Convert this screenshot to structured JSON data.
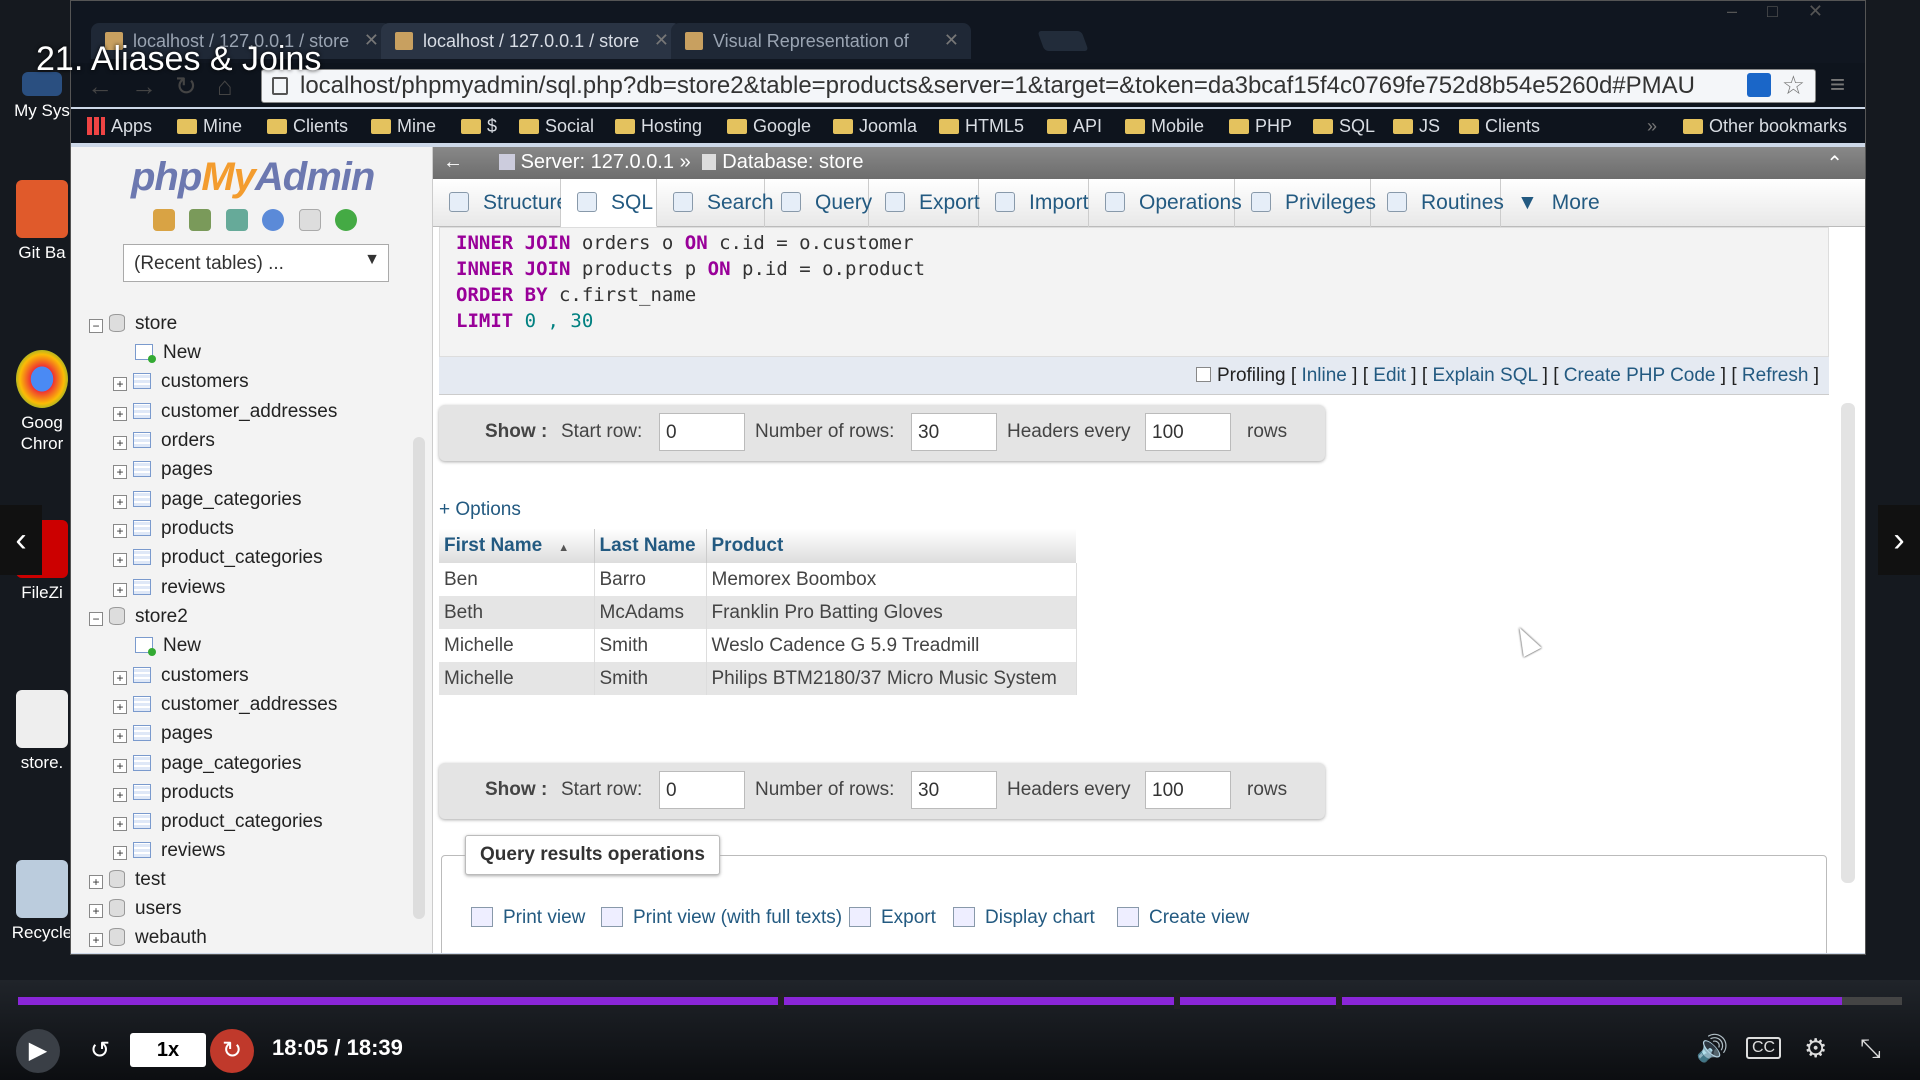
{
  "video": {
    "title": "21. Aliases & Joins",
    "speed": "1x",
    "time": "18:05 / 18:39",
    "progress_fraction": 0.968
  },
  "desktop": {
    "icons": [
      "My Sys",
      "Git Ba",
      "Goog Chror",
      "FileZi",
      "store.",
      "Recycle"
    ]
  },
  "browser": {
    "tabs": [
      {
        "title": "localhost / 127.0.0.1 / store"
      },
      {
        "title": "localhost / 127.0.0.1 / store"
      },
      {
        "title": "Visual Representation of"
      }
    ],
    "url": "localhost/phpmyadmin/sql.php?db=store2&table=products&server=1&target=&token=da3bcaf15f4c0769fe752d8b54e5260d#PMAU",
    "bookmarks": [
      "Apps",
      "Mine",
      "Clients",
      "Mine",
      "$",
      "Social",
      "Hosting",
      "Google",
      "Joomla",
      "HTML5",
      "API",
      "Mobile",
      "PHP",
      "SQL",
      "JS",
      "Clients"
    ],
    "bookmarks_more": "»",
    "other_bookmarks": "Other bookmarks"
  },
  "sidebar": {
    "logo": {
      "php": "php",
      "my": "My",
      "admin": "Admin"
    },
    "recent_tables": "(Recent tables) ...",
    "tree": [
      {
        "label": "store",
        "type": "db",
        "expanded": true
      },
      {
        "label": "New",
        "type": "new"
      },
      {
        "label": "customers",
        "type": "table"
      },
      {
        "label": "customer_addresses",
        "type": "table"
      },
      {
        "label": "orders",
        "type": "table"
      },
      {
        "label": "pages",
        "type": "table"
      },
      {
        "label": "page_categories",
        "type": "table"
      },
      {
        "label": "products",
        "type": "table"
      },
      {
        "label": "product_categories",
        "type": "table"
      },
      {
        "label": "reviews",
        "type": "table"
      },
      {
        "label": "store2",
        "type": "db",
        "expanded": true
      },
      {
        "label": "New",
        "type": "new"
      },
      {
        "label": "customers",
        "type": "table"
      },
      {
        "label": "customer_addresses",
        "type": "table"
      },
      {
        "label": "pages",
        "type": "table"
      },
      {
        "label": "page_categories",
        "type": "table"
      },
      {
        "label": "products",
        "type": "table"
      },
      {
        "label": "product_categories",
        "type": "table"
      },
      {
        "label": "reviews",
        "type": "table"
      },
      {
        "label": "test",
        "type": "db",
        "expanded": false
      },
      {
        "label": "users",
        "type": "db",
        "expanded": false
      },
      {
        "label": "webauth",
        "type": "db",
        "expanded": false
      }
    ]
  },
  "breadcrumb": {
    "back": "←",
    "server": "Server: 127.0.0.1",
    "sep": "»",
    "database": "Database: store",
    "collapse": "⌃"
  },
  "tabs": [
    "Structure",
    "SQL",
    "Search",
    "Query",
    "Export",
    "Import",
    "Operations",
    "Privileges",
    "Routines",
    "More"
  ],
  "active_tab": "SQL",
  "sql": {
    "line1": {
      "kw": "INNER JOIN",
      "rest": " orders o ",
      "kw2": "ON",
      "rest2": " c.id = o.customer"
    },
    "line2": {
      "kw": "INNER JOIN",
      "rest": " products p ",
      "kw2": "ON",
      "rest2": " p.id = o.product"
    },
    "line3": {
      "kw": "ORDER BY",
      "rest": " c.first_name"
    },
    "line4": {
      "kw": "LIMIT",
      "n1": " 0",
      "comma": " ,",
      "n2": " 30"
    }
  },
  "profiling": {
    "label": "Profiling",
    "links": [
      "Inline",
      "Edit",
      "Explain SQL",
      "Create PHP Code",
      "Refresh"
    ]
  },
  "show": {
    "show_label": "Show :",
    "start_row_label": "Start row:",
    "start_row": "0",
    "num_rows_label": "Number of rows:",
    "num_rows": "30",
    "headers_label": "Headers every",
    "headers": "100",
    "rows_label": "rows"
  },
  "options_link": "+ Options",
  "results": {
    "columns": [
      "First Name",
      "Last Name",
      "Product"
    ],
    "rows": [
      [
        "Ben",
        "Barro",
        "Memorex Boombox"
      ],
      [
        "Beth",
        "McAdams",
        "Franklin Pro Batting Gloves"
      ],
      [
        "Michelle",
        "Smith",
        "Weslo Cadence G 5.9 Treadmill"
      ],
      [
        "Michelle",
        "Smith",
        "Philips BTM2180/37 Micro Music System"
      ]
    ]
  },
  "query_ops": {
    "legend": "Query results operations",
    "items": [
      "Print view",
      "Print view (with full texts)",
      "Export",
      "Display chart",
      "Create view"
    ]
  },
  "colors": {
    "accent": "#8a26d8",
    "link": "#235a81",
    "keyword": "#990099"
  }
}
